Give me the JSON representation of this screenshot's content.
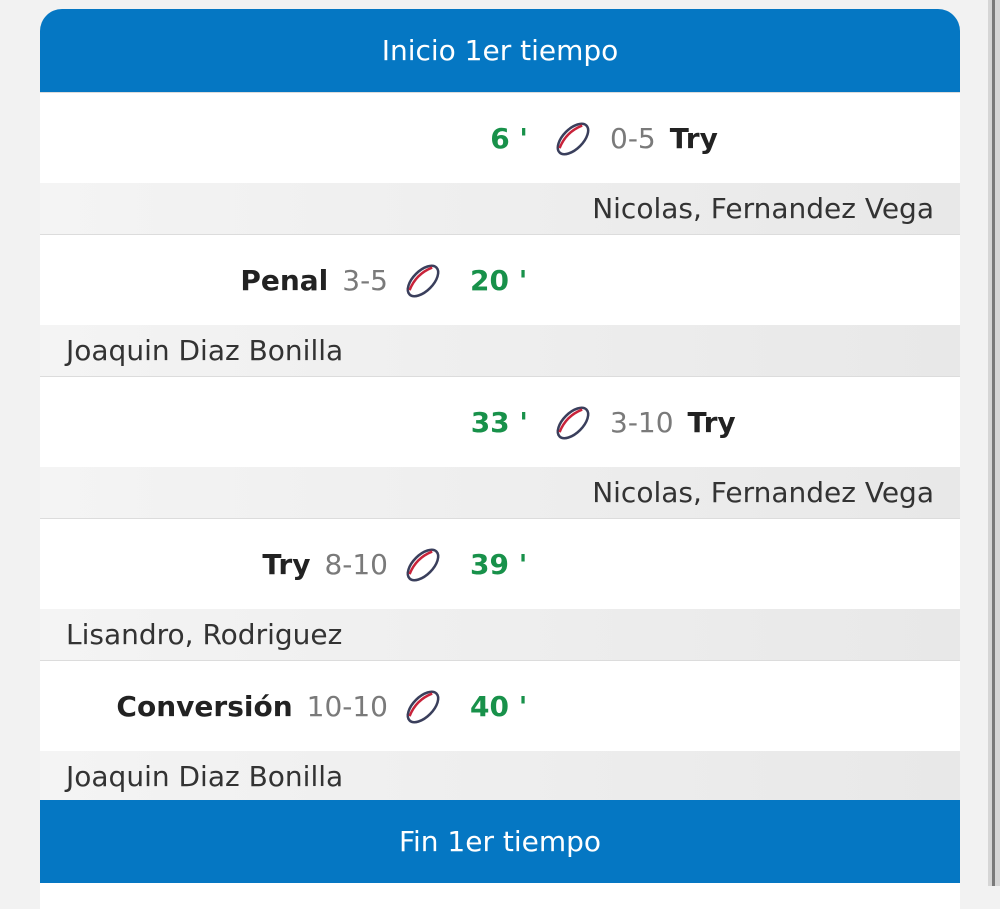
{
  "period": {
    "start_label": "Inicio 1er tiempo",
    "end_label": "Fin 1er tiempo"
  },
  "colors": {
    "header_bg": "#0577c3",
    "minute": "#18914a"
  },
  "events": [
    {
      "side": "away",
      "minute": "6 '",
      "score": "0-5",
      "type": "Try",
      "player": "Nicolas, Fernandez Vega",
      "icon": "rugby-ball-icon"
    },
    {
      "side": "home",
      "minute": "20 '",
      "score": "3-5",
      "type": "Penal",
      "player": "Joaquin Diaz Bonilla",
      "icon": "rugby-ball-icon"
    },
    {
      "side": "away",
      "minute": "33 '",
      "score": "3-10",
      "type": "Try",
      "player": "Nicolas, Fernandez Vega",
      "icon": "rugby-ball-icon"
    },
    {
      "side": "home",
      "minute": "39 '",
      "score": "8-10",
      "type": "Try",
      "player": "Lisandro, Rodriguez",
      "icon": "rugby-ball-icon"
    },
    {
      "side": "home",
      "minute": "40 '",
      "score": "10-10",
      "type": "Conversión",
      "player": "Joaquin Diaz Bonilla",
      "icon": "rugby-ball-icon"
    }
  ]
}
